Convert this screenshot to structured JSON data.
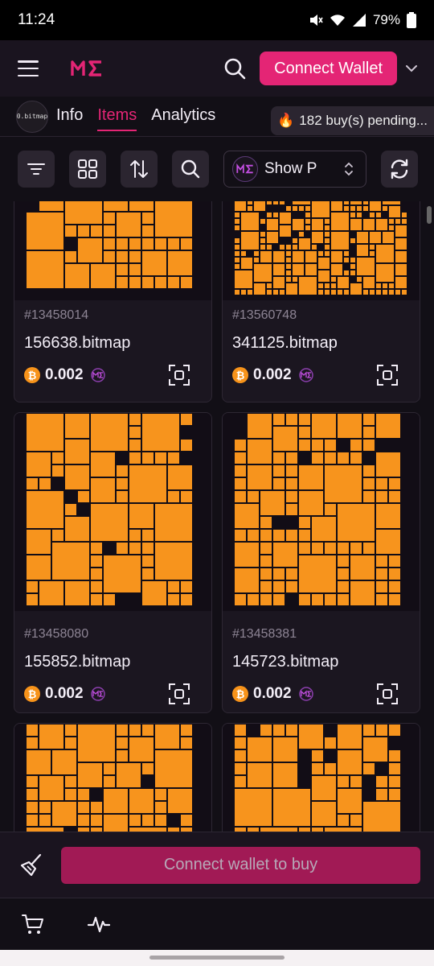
{
  "status_bar": {
    "time": "11:24",
    "battery": "79%"
  },
  "header": {
    "connect_label": "Connect Wallet"
  },
  "tabs": {
    "avatar_text": "0.bitmap",
    "items": [
      {
        "label": "Info"
      },
      {
        "label": "Items"
      },
      {
        "label": "Analytics"
      }
    ],
    "active": "Items",
    "pending_icon": "🔥",
    "pending_text": "182 buy(s) pending..."
  },
  "toolbar": {
    "show_label": "Show P"
  },
  "cards": [
    {
      "inscription": "#13458014",
      "name": "156638.bitmap",
      "price": "0.002"
    },
    {
      "inscription": "#13560748",
      "name": "341125.bitmap",
      "price": "0.002"
    },
    {
      "inscription": "#13458080",
      "name": "155852.bitmap",
      "price": "0.002"
    },
    {
      "inscription": "#13458381",
      "name": "145723.bitmap",
      "price": "0.002"
    },
    {
      "inscription": "",
      "name": "",
      "price": ""
    },
    {
      "inscription": "",
      "name": "",
      "price": ""
    }
  ],
  "currency_symbol": "₿",
  "buy_bar": {
    "buy_label": "Connect wallet to buy"
  },
  "colors": {
    "accent": "#e42575",
    "bitmap_orange": "#f7941d",
    "background": "#120f16"
  },
  "icons": {
    "header": [
      "hamburger-icon",
      "magic-eden-logo",
      "search-icon",
      "chevron-down-icon"
    ],
    "toolbar": [
      "filter-icon",
      "grid-icon",
      "sort-icon",
      "search-icon",
      "refresh-icon"
    ],
    "card": [
      "bitcoin-icon",
      "magic-eden-icon",
      "scan-icon"
    ],
    "bottom": [
      "broom-icon",
      "cart-icon",
      "activity-icon"
    ]
  }
}
